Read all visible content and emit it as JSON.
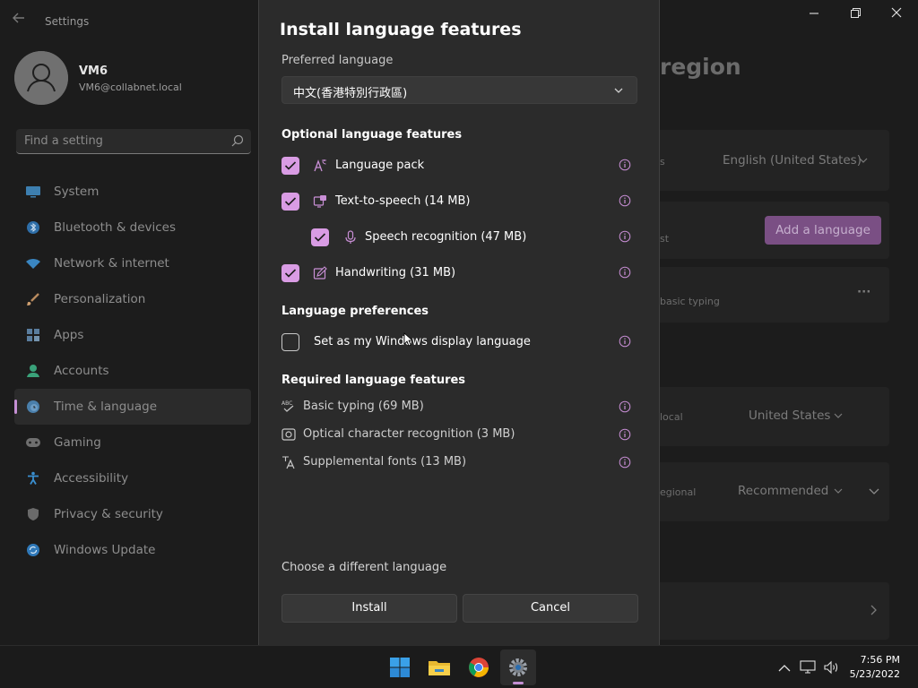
{
  "window": {
    "app_title": "Settings",
    "minimize": "—",
    "maximize": "❐",
    "close": "✕"
  },
  "profile": {
    "name": "VM6",
    "email": "VM6@collabnet.local"
  },
  "search": {
    "placeholder": "Find a setting"
  },
  "sidebar": {
    "items": [
      {
        "label": "System",
        "icon": "monitor-icon"
      },
      {
        "label": "Bluetooth & devices",
        "icon": "bluetooth-icon"
      },
      {
        "label": "Network & internet",
        "icon": "wifi-icon"
      },
      {
        "label": "Personalization",
        "icon": "brush-icon"
      },
      {
        "label": "Apps",
        "icon": "apps-icon"
      },
      {
        "label": "Accounts",
        "icon": "person-icon"
      },
      {
        "label": "Time & language",
        "icon": "globe-clock-icon",
        "selected": true
      },
      {
        "label": "Gaming",
        "icon": "gamepad-icon"
      },
      {
        "label": "Accessibility",
        "icon": "accessibility-icon"
      },
      {
        "label": "Privacy & security",
        "icon": "shield-icon"
      },
      {
        "label": "Windows Update",
        "icon": "update-icon"
      }
    ]
  },
  "background": {
    "page_title_fragment": "region",
    "windows_display_language": "English (United States)",
    "add_language_button": "Add a language",
    "frag_s": "s",
    "frag_st": "st",
    "frag_basic_typing": "basic typing",
    "more": "···",
    "frag_local": "local",
    "country": "United States",
    "frag_regional": "egional",
    "regional_format": "Recommended"
  },
  "dialog": {
    "title": "Install language features",
    "preferred_language_label": "Preferred language",
    "preferred_language_value": "中文(香港特別行政區)",
    "optional_heading": "Optional language features",
    "optional": {
      "language_pack": {
        "label": "Language pack",
        "checked": true
      },
      "tts": {
        "label": "Text-to-speech (14 MB)",
        "checked": true
      },
      "speech": {
        "label": "Speech recognition (47 MB)",
        "checked": true
      },
      "handwriting": {
        "label": "Handwriting (31 MB)",
        "checked": true
      }
    },
    "preferences_heading": "Language preferences",
    "display_language": {
      "label": "Set as my Windows display language",
      "checked": false
    },
    "required_heading": "Required language features",
    "required": {
      "basic_typing": "Basic typing (69 MB)",
      "ocr": "Optical character recognition (3 MB)",
      "fonts": "Supplemental fonts (13 MB)"
    },
    "choose_link": "Choose a different language",
    "install_button": "Install",
    "cancel_button": "Cancel"
  },
  "taskbar": {
    "apps": [
      "windows-start-icon",
      "file-explorer-icon",
      "chrome-icon",
      "settings-icon"
    ],
    "time": "7:56 PM",
    "date": "5/23/2022"
  },
  "colors": {
    "accent": "#d99ce4",
    "accent_dark": "#7a4f84",
    "dialog_bg": "#2b2b2b",
    "background": "#1c1c1c"
  }
}
